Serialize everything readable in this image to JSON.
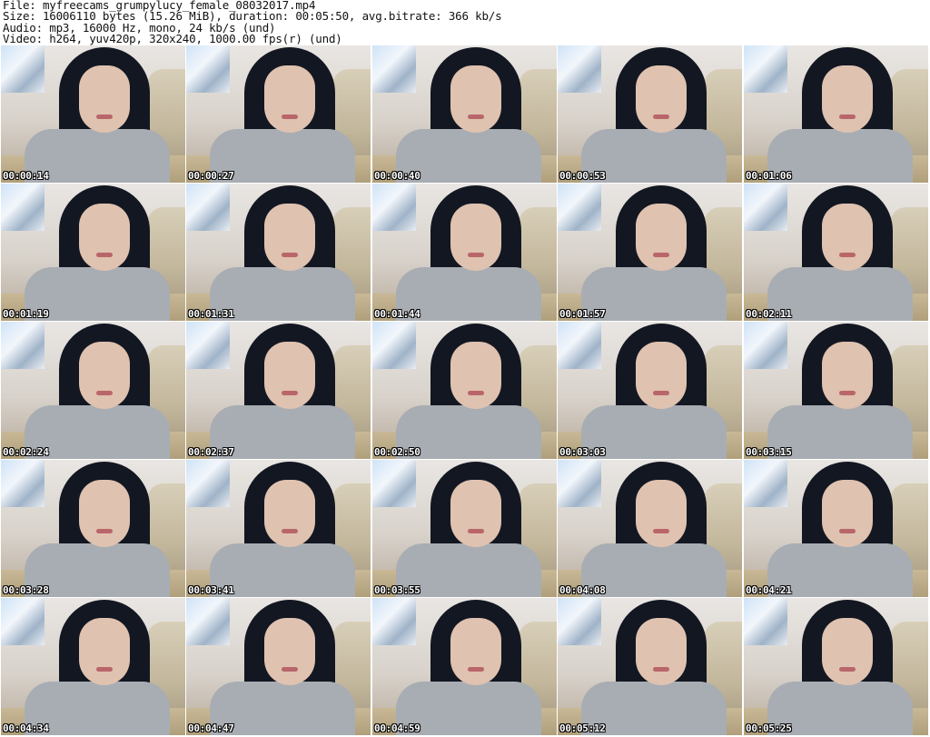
{
  "header": {
    "file_line": "File: myfreecams_grumpylucy_female_08032017.mp4",
    "size_line": "Size: 16006110 bytes (15.26 MiB), duration: 00:05:50, avg.bitrate: 366 kb/s",
    "audio_line": "Audio: mp3, 16000 Hz, mono, 24 kb/s (und)",
    "video_line": "Video: h264, yuv420p, 320x240, 1000.00 fps(r) (und)"
  },
  "thumbnails": [
    {
      "timestamp": "00:00:14"
    },
    {
      "timestamp": "00:00:27"
    },
    {
      "timestamp": "00:00:40"
    },
    {
      "timestamp": "00:00:53"
    },
    {
      "timestamp": "00:01:06"
    },
    {
      "timestamp": "00:01:19"
    },
    {
      "timestamp": "00:01:31"
    },
    {
      "timestamp": "00:01:44"
    },
    {
      "timestamp": "00:01:57"
    },
    {
      "timestamp": "00:02:11"
    },
    {
      "timestamp": "00:02:24"
    },
    {
      "timestamp": "00:02:37"
    },
    {
      "timestamp": "00:02:50"
    },
    {
      "timestamp": "00:03:03"
    },
    {
      "timestamp": "00:03:15"
    },
    {
      "timestamp": "00:03:28"
    },
    {
      "timestamp": "00:03:41"
    },
    {
      "timestamp": "00:03:55"
    },
    {
      "timestamp": "00:04:08"
    },
    {
      "timestamp": "00:04:21"
    },
    {
      "timestamp": "00:04:34"
    },
    {
      "timestamp": "00:04:47"
    },
    {
      "timestamp": "00:04:59"
    },
    {
      "timestamp": "00:05:12"
    },
    {
      "timestamp": "00:05:25"
    }
  ]
}
